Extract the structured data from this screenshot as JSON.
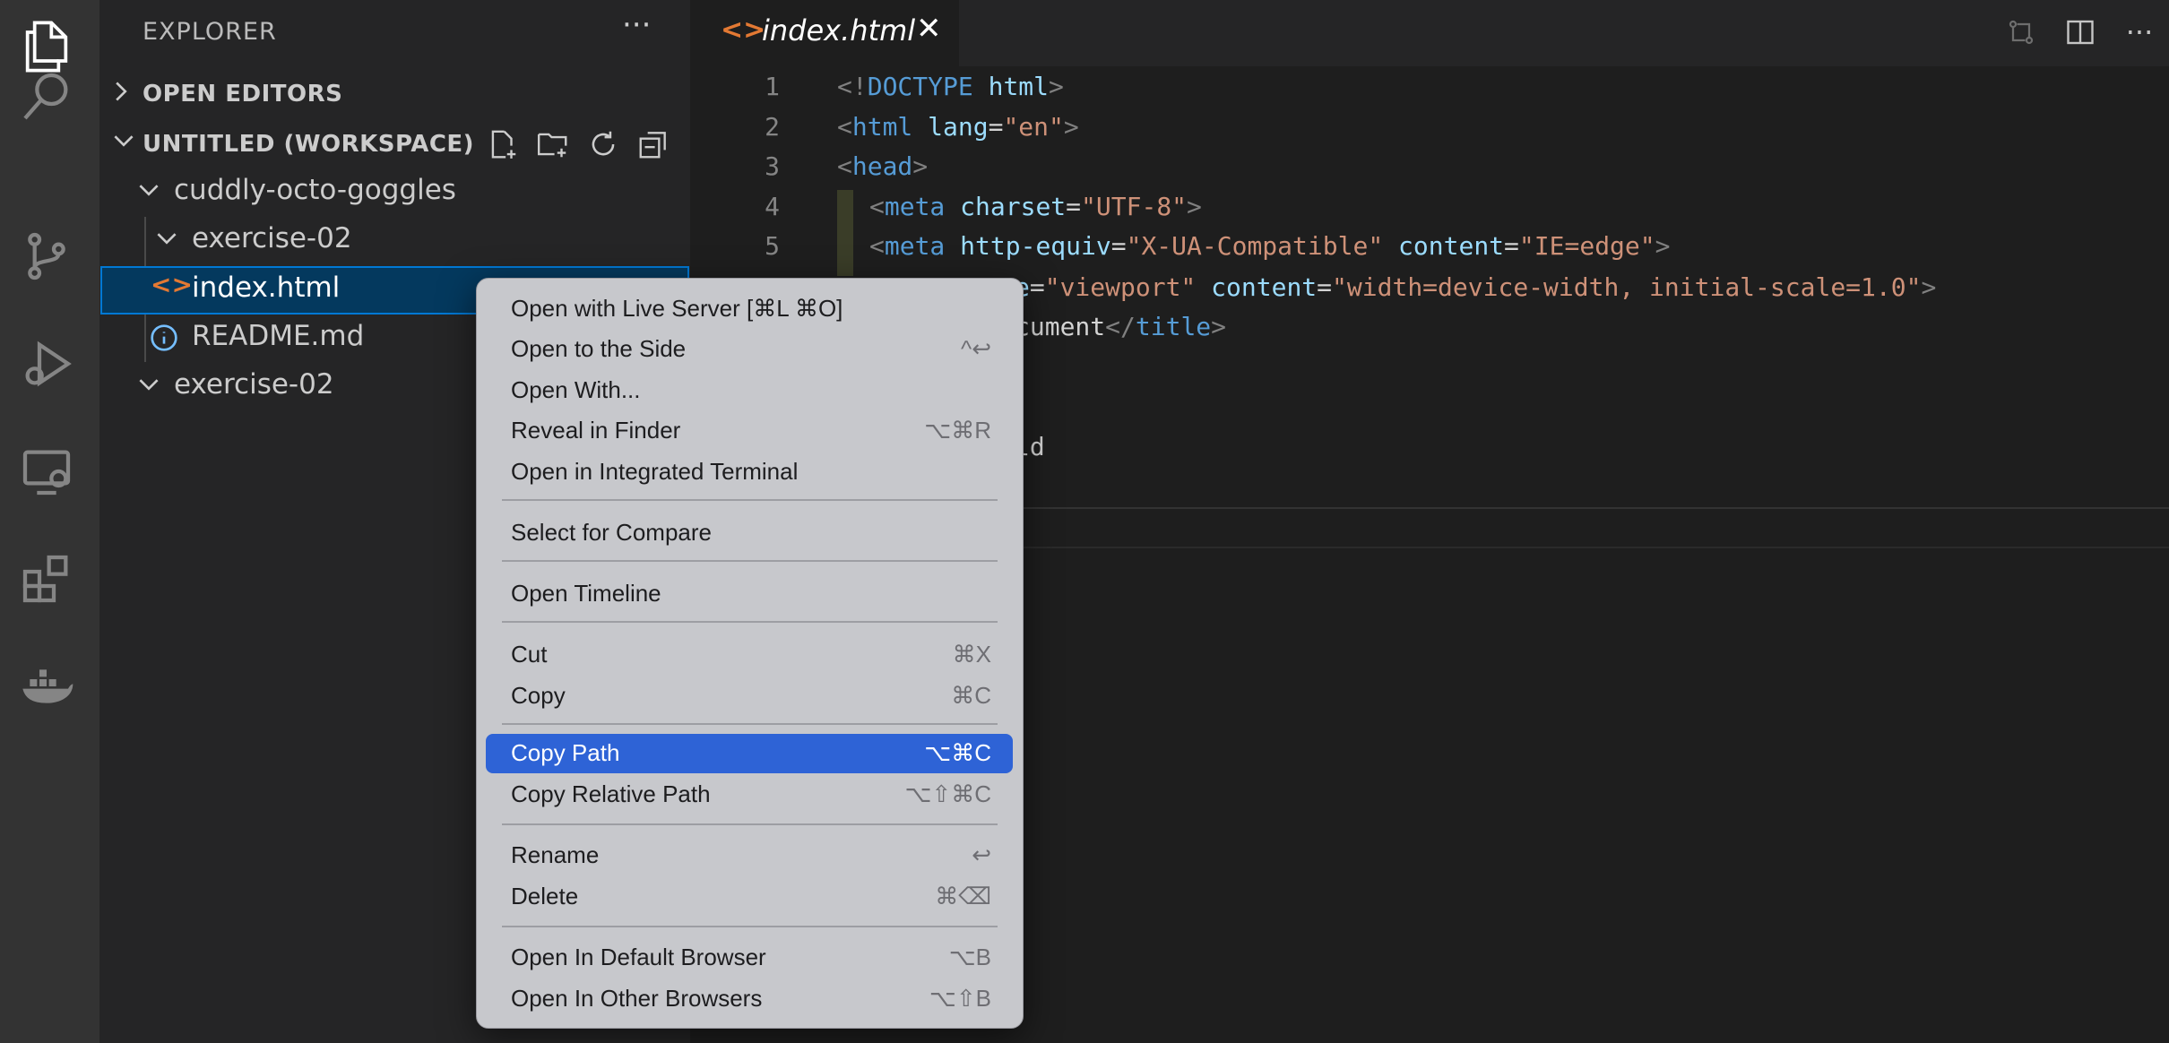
{
  "activity_bar": {
    "icons": [
      "explorer-icon",
      "search-icon",
      "source-control-icon",
      "run-debug-icon",
      "remote-explorer-icon",
      "extensions-icon",
      "docker-icon"
    ]
  },
  "sidebar": {
    "title": "EXPLORER",
    "more": "···",
    "sections": {
      "open_editors": "OPEN EDITORS",
      "workspace": "UNTITLED (WORKSPACE)"
    },
    "tree": {
      "folder1": "cuddly-octo-goggles",
      "folder1_child": "exercise-02",
      "file_html": "index.html",
      "file_readme": "README.md",
      "folder2": "exercise-02"
    }
  },
  "editor": {
    "tab_name": "index.html",
    "tab_close": "✕",
    "line_numbers": [
      "1",
      "2",
      "3",
      "4",
      "5"
    ],
    "partial": {
      "line6": "e=\"viewport\" content=\"width=device-width, initial-scale=1.0\">",
      "line7": "cument</title>",
      "line9": "ld"
    }
  },
  "context_menu": {
    "items": [
      {
        "label": "Open with Live Server [⌘L ⌘O]",
        "shortcut": ""
      },
      {
        "label": "Open to the Side",
        "shortcut": "^↩"
      },
      {
        "label": "Open With...",
        "shortcut": ""
      },
      {
        "label": "Reveal in Finder",
        "shortcut": "⌥⌘R"
      },
      {
        "label": "Open in Integrated Terminal",
        "shortcut": ""
      },
      {
        "label": "Select for Compare",
        "shortcut": ""
      },
      {
        "label": "Open Timeline",
        "shortcut": ""
      },
      {
        "label": "Cut",
        "shortcut": "⌘X"
      },
      {
        "label": "Copy",
        "shortcut": "⌘C"
      },
      {
        "label": "Copy Path",
        "shortcut": "⌥⌘C"
      },
      {
        "label": "Copy Relative Path",
        "shortcut": "⌥⇧⌘C"
      },
      {
        "label": "Rename",
        "shortcut": "↩"
      },
      {
        "label": "Delete",
        "shortcut": "⌘⌫"
      },
      {
        "label": "Open In Default Browser",
        "shortcut": "⌥B"
      },
      {
        "label": "Open In Other Browsers",
        "shortcut": "⌥⇧B"
      }
    ],
    "active_index": 9
  },
  "colors": {
    "activity_bg": "#333333",
    "sidebar_bg": "#252526",
    "editor_bg": "#1e1e1e",
    "selection": "#04395e",
    "menu_bg": "#c7c8cc",
    "menu_active": "#2e63d6",
    "html_icon": "#e37933",
    "info_icon": "#75beff"
  }
}
